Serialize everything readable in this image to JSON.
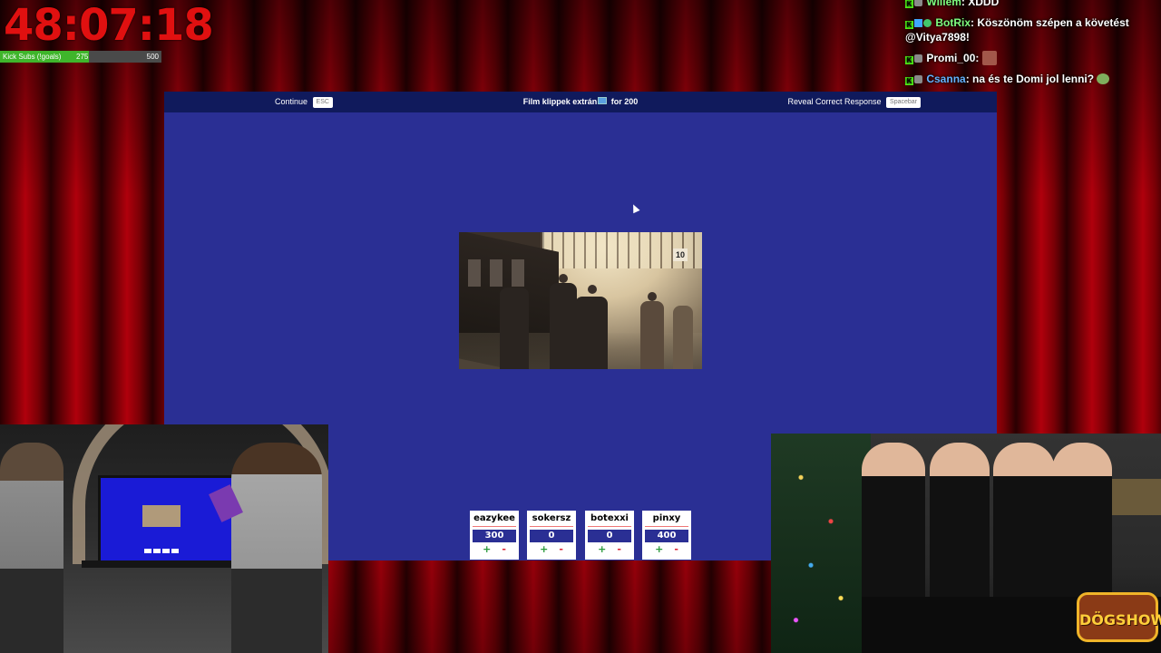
{
  "timer": {
    "display": "48:07:18"
  },
  "subs_goal": {
    "label": "Kick Subs (!goals)",
    "current": "275",
    "goal": "500",
    "progress": 0.55
  },
  "chat": {
    "messages": [
      {
        "user": "Willem",
        "text": "XDDD",
        "user_color": "#7fff7f"
      },
      {
        "user": "BotRix",
        "text": "Köszönöm szépen a követést @Vitya7898!",
        "user_color": "#7fff7f"
      },
      {
        "user": "Promi_00",
        "text": "",
        "user_color": "#ffffff"
      },
      {
        "user": "Csanna",
        "text": "na és te Domi jol lenni?",
        "user_color": "#66b3ff"
      }
    ]
  },
  "game": {
    "continue_label": "Continue",
    "continue_key": "ESC",
    "title_prefix": "Film klippek extrán",
    "title_suffix": "for 200",
    "reveal_label": "Reveal Correct Response",
    "reveal_key": "Spacebar",
    "clip_sign": "10",
    "bg_color": "#2a2f94"
  },
  "players": [
    {
      "name": "eazykee",
      "score": "300",
      "plus": "+",
      "minus": "-"
    },
    {
      "name": "sokersz",
      "score": "0",
      "plus": "+",
      "minus": "-"
    },
    {
      "name": "botexxi",
      "score": "0",
      "plus": "+",
      "minus": "-"
    },
    {
      "name": "pinxy",
      "score": "400",
      "plus": "+",
      "minus": "-"
    }
  ],
  "logo": {
    "text": "DÖGSHOW"
  }
}
